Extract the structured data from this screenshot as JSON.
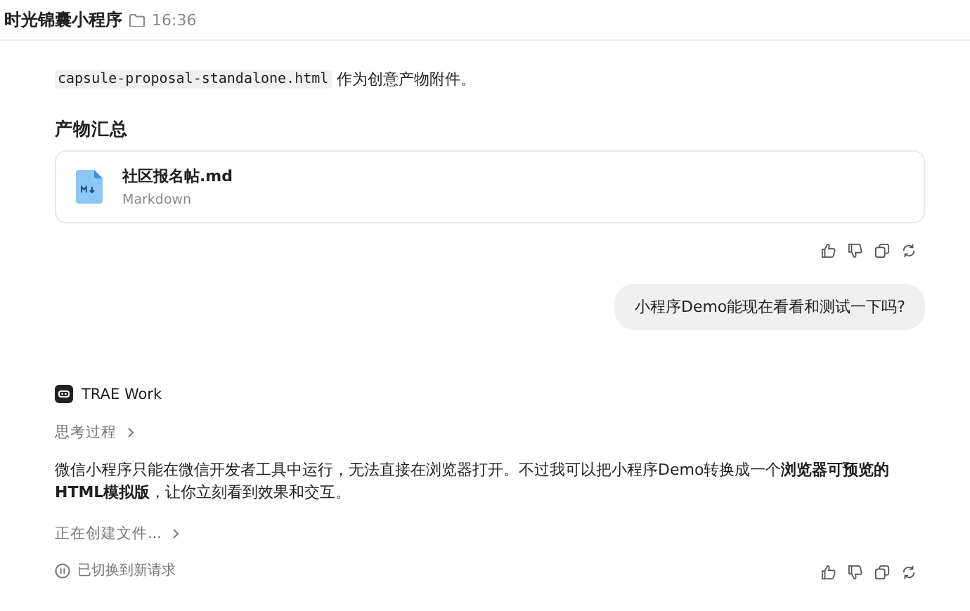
{
  "header": {
    "title": "时光锦囊小程序",
    "time": "16:36"
  },
  "intro": {
    "code": "capsule-proposal-standalone.html",
    "text": "作为创意产物附件。"
  },
  "artifacts": {
    "heading": "产物汇总",
    "files": [
      {
        "name": "社区报名帖.md",
        "type": "Markdown"
      }
    ]
  },
  "user_message": "小程序Demo能现在看看和测试一下吗?",
  "assistant": {
    "name": "TRAE Work",
    "thinking": "思考过程",
    "answer": "微信小程序只能在微信开发者工具中运行，无法直接在浏览器打开。不过我可以把小程序Demo转换成一个**浏览器可预览的HTML模拟版**，让你立刻看到效果和交互。",
    "progress": "正在创建文件..."
  },
  "status": "已切换到新请求"
}
